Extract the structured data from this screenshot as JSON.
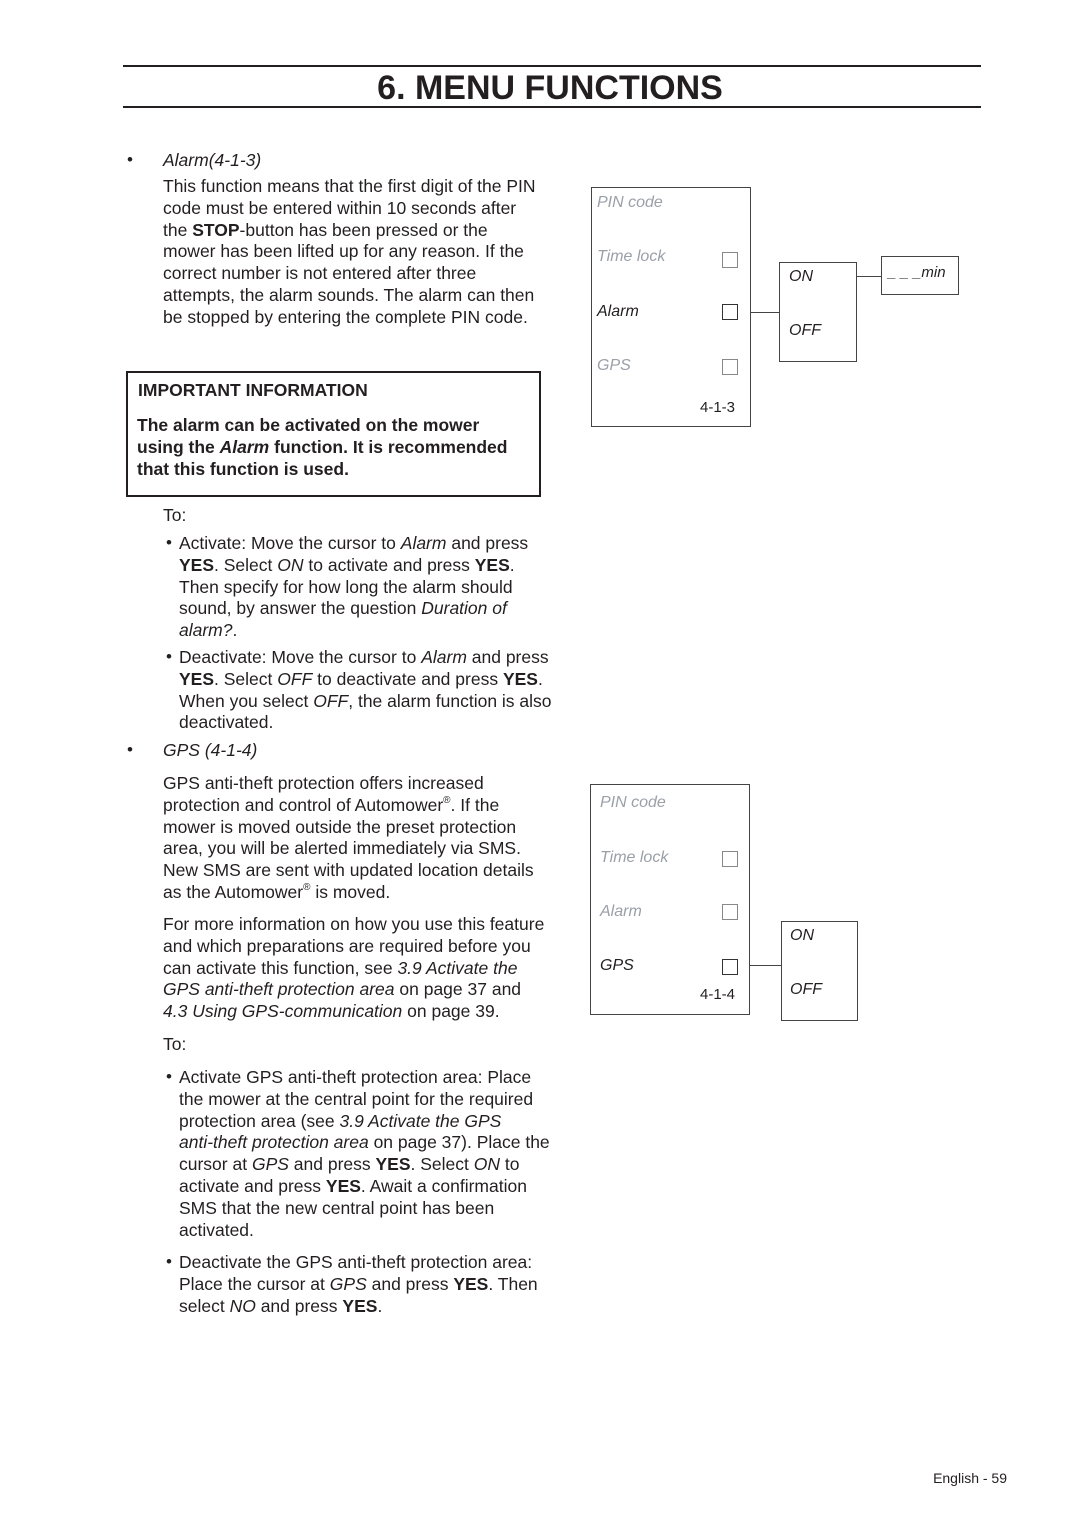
{
  "header": {
    "title": "6. MENU FUNCTIONS"
  },
  "alarm": {
    "bullet": "•",
    "heading": "Alarm(4-1-3)",
    "body": [
      [
        [
          "This function means that the first digit of the PIN",
          ""
        ]
      ],
      [
        [
          "code must be entered within 10 seconds after",
          ""
        ]
      ],
      [
        [
          "the ",
          ""
        ],
        [
          "STOP",
          "b"
        ],
        [
          "-button has been pressed or the",
          ""
        ]
      ],
      [
        [
          "mower has been lifted up for any reason. If the",
          ""
        ]
      ],
      [
        [
          "correct number is not entered after three",
          ""
        ]
      ],
      [
        [
          "attempts, the alarm sounds. The alarm can then",
          ""
        ]
      ],
      [
        [
          "be stopped by entering the complete PIN code.",
          ""
        ]
      ]
    ],
    "to": "To:",
    "steps": [
      [
        [
          [
            "Activate: Move the cursor to ",
            ""
          ],
          [
            "Alarm",
            "i"
          ],
          [
            " and press",
            ""
          ]
        ],
        [
          [
            "YES",
            "b"
          ],
          [
            ". Select ",
            ""
          ],
          [
            "ON",
            "i"
          ],
          [
            " to activate and press ",
            ""
          ],
          [
            "YES",
            "b"
          ],
          [
            ".",
            ""
          ]
        ],
        [
          [
            "Then specify for how long the alarm should",
            ""
          ]
        ],
        [
          [
            "sound, by answer the question ",
            ""
          ],
          [
            "Duration of",
            "i"
          ]
        ],
        [
          [
            "alarm?",
            "i"
          ],
          [
            ".",
            ""
          ]
        ]
      ],
      [
        [
          [
            "Deactivate: Move the cursor to ",
            ""
          ],
          [
            "Alarm",
            "i"
          ],
          [
            " and press",
            ""
          ]
        ],
        [
          [
            "YES",
            "b"
          ],
          [
            ". Select ",
            ""
          ],
          [
            "OFF",
            "i"
          ],
          [
            " to deactivate and press ",
            ""
          ],
          [
            "YES",
            "b"
          ],
          [
            ".",
            ""
          ]
        ],
        [
          [
            "When you select ",
            ""
          ],
          [
            "OFF",
            "i"
          ],
          [
            ", the alarm function is also",
            ""
          ]
        ],
        [
          [
            "deactivated.",
            ""
          ]
        ]
      ]
    ]
  },
  "important": {
    "heading": "IMPORTANT INFORMATION",
    "body": [
      [
        [
          "The alarm can be activated on the mower",
          "b"
        ]
      ],
      [
        [
          "using the ",
          "b"
        ],
        [
          "Alarm",
          "bi"
        ],
        [
          " function. It is recommended",
          "b"
        ]
      ],
      [
        [
          "that this function is used.",
          "b"
        ]
      ]
    ]
  },
  "gps": {
    "bullet": "•",
    "heading": "GPS (4-1-4)",
    "body1": [
      [
        [
          "GPS anti-theft protection offers increased",
          ""
        ]
      ],
      [
        [
          "protection and control of Automower",
          ""
        ],
        [
          "®",
          "sup"
        ],
        [
          ". If the",
          ""
        ]
      ],
      [
        [
          "mower is moved outside the preset protection",
          ""
        ]
      ],
      [
        [
          "area, you will be alerted immediately via SMS.",
          ""
        ]
      ],
      [
        [
          "New SMS are sent with updated location details",
          ""
        ]
      ],
      [
        [
          "as the Automower",
          ""
        ],
        [
          "®",
          "sup"
        ],
        [
          " is moved.",
          ""
        ]
      ]
    ],
    "body2": [
      [
        [
          "For more information on how you use this feature",
          ""
        ]
      ],
      [
        [
          "and which preparations are required before you",
          ""
        ]
      ],
      [
        [
          "can activate this function, see ",
          ""
        ],
        [
          "3.9 Activate the",
          "i"
        ]
      ],
      [
        [
          "GPS anti-theft protection area",
          "i"
        ],
        [
          " on page 37 and",
          ""
        ]
      ],
      [
        [
          "4.3 Using GPS-communication",
          "i"
        ],
        [
          " on page 39.",
          ""
        ]
      ]
    ],
    "to": "To:",
    "steps": [
      [
        [
          [
            "Activate GPS anti-theft protection area: Place",
            ""
          ]
        ],
        [
          [
            "the mower at the central point for the required",
            ""
          ]
        ],
        [
          [
            "protection area (see ",
            ""
          ],
          [
            "3.9 Activate the GPS",
            "i"
          ]
        ],
        [
          [
            "anti-theft protection area",
            "i"
          ],
          [
            " on page 37). Place the",
            ""
          ]
        ],
        [
          [
            "cursor at ",
            ""
          ],
          [
            "GPS",
            "i"
          ],
          [
            " and press ",
            ""
          ],
          [
            "YES",
            "b"
          ],
          [
            ". Select ",
            ""
          ],
          [
            "ON",
            "i"
          ],
          [
            " to",
            ""
          ]
        ],
        [
          [
            "activate and press ",
            ""
          ],
          [
            "YES",
            "b"
          ],
          [
            ". Await a confirmation",
            ""
          ]
        ],
        [
          [
            "SMS that the new central point has been",
            ""
          ]
        ],
        [
          [
            "activated.",
            ""
          ]
        ]
      ],
      [
        [
          [
            "Deactivate the GPS anti-theft protection area:",
            ""
          ]
        ],
        [
          [
            "Place the cursor at ",
            ""
          ],
          [
            "GPS",
            "i"
          ],
          [
            " and press ",
            ""
          ],
          [
            "YES",
            "b"
          ],
          [
            ". Then",
            ""
          ]
        ],
        [
          [
            "select ",
            ""
          ],
          [
            "NO",
            "i"
          ],
          [
            " and press ",
            ""
          ],
          [
            "YES",
            "b"
          ],
          [
            ".",
            ""
          ]
        ]
      ]
    ]
  },
  "diagram1": {
    "items": [
      "PIN code",
      "Time lock",
      "Alarm",
      "GPS"
    ],
    "active": "Alarm",
    "code": "4-1-3",
    "options": [
      "ON",
      "OFF"
    ],
    "duration": "_ _ _min"
  },
  "diagram2": {
    "items": [
      "PIN code",
      "Time lock",
      "Alarm",
      "GPS"
    ],
    "active": "GPS",
    "code": "4-1-4",
    "options": [
      "ON",
      "OFF"
    ]
  },
  "footer": {
    "page_label": "English - 59"
  }
}
